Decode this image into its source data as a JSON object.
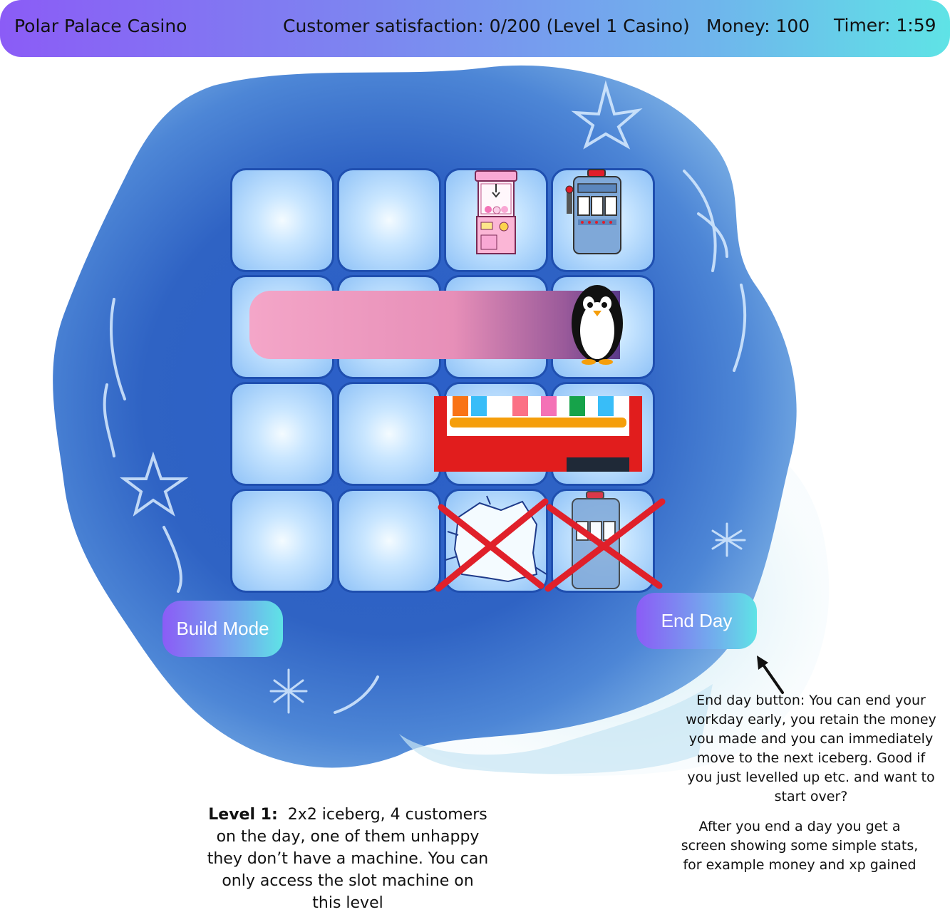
{
  "topbar": {
    "title": "Polar Palace Casino",
    "satisfaction": "Customer satisfaction: 0/200 (Level 1 Casino)",
    "money": "Money: 100",
    "timer": "Timer: 1:59"
  },
  "buttons": {
    "build_mode": "Build Mode",
    "end_day": "End Day"
  },
  "notes": {
    "end_day_note": "End day button: You can end your workday early, you retain the money you made and you can immediately move to the next iceberg. Good if you just levelled up etc. and want to start over?",
    "after_end_note": "After you end a day you get a screen showing some simple stats, for example money and xp gained",
    "level_heading": "Level 1:",
    "level_text": "2x2 iceberg, 4 customers on the day, one of them unhappy they don’t have a machine. You can only access the slot machine on this level"
  },
  "grid": {
    "rows": 4,
    "cols": 4,
    "items": [
      "claw-machine",
      "slot-machine",
      "penguin-customer",
      "vending-machine",
      "cracked-ice-crossed",
      "slot-machine-crossed"
    ]
  },
  "colors": {
    "accent_purple": "#8b5cf6",
    "accent_cyan": "#5fe3e6",
    "tile_border": "#1f4fb0",
    "cross_red": "#e0202a"
  }
}
